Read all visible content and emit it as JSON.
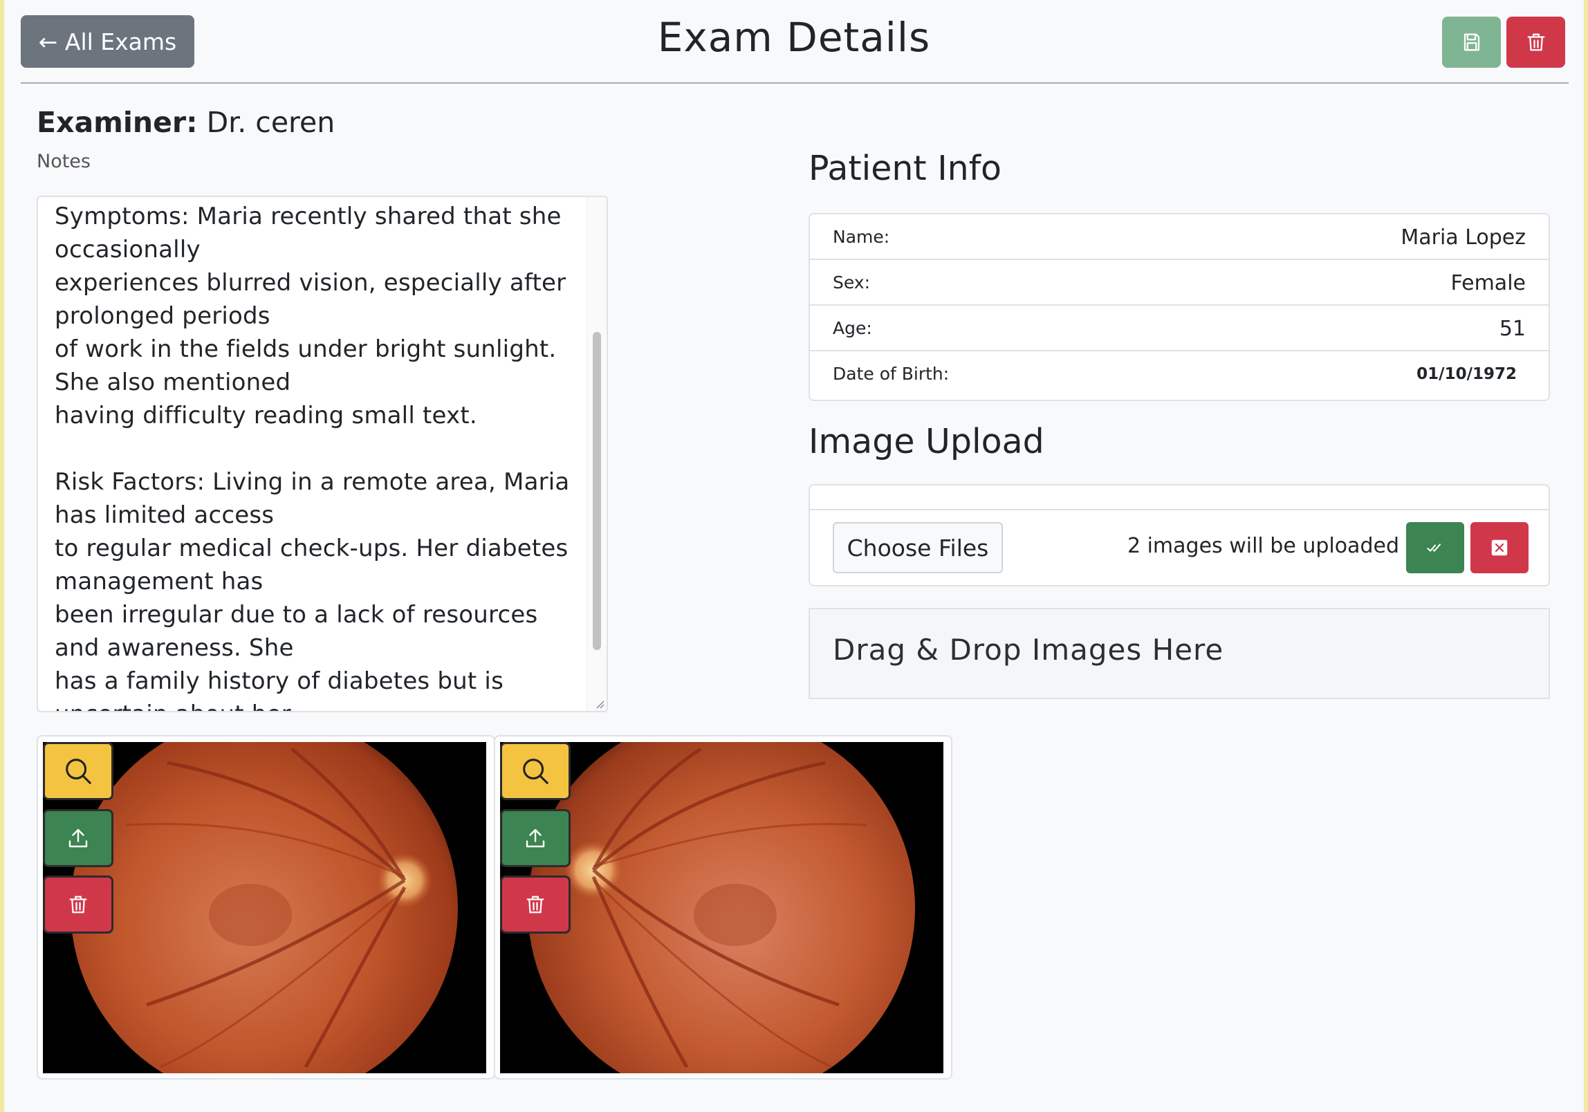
{
  "header": {
    "back_label": "← All Exams",
    "title": "Exam Details",
    "save_icon": "save-icon",
    "delete_icon": "trash-icon"
  },
  "examiner": {
    "label": "Examiner:",
    "name": "Dr. ceren"
  },
  "notes": {
    "label": "Notes",
    "text": "Symptoms: Maria recently shared that she occasionally\nexperiences blurred vision, especially after prolonged periods\nof work in the fields under bright sunlight. She also mentioned\nhaving difficulty reading small text.\n\nRisk Factors: Living in a remote area, Maria has limited access\nto regular medical check-ups. Her diabetes management has\nbeen irregular due to a lack of resources and awareness. She\nhas a family history of diabetes but is uncertain about her\nfamily's history of eye-related conditions.\n\nConvincing Evidence for Screening: Considering Maria's\nprolonged duration of diabetes and the visual disturbances she\nexperiences, it is crucial to examine her retinal health\nthoroughly. The tele-medicine consultation with a specialist\nwill be instrumental in detecting any early signs of diabetic"
  },
  "patient_info": {
    "heading": "Patient Info",
    "rows": [
      {
        "label": "Name:",
        "value": "Maria Lopez"
      },
      {
        "label": "Sex:",
        "value": "Female"
      },
      {
        "label": "Age:",
        "value": "51"
      },
      {
        "label": "Date of Birth:",
        "value": "01/10/1972"
      }
    ]
  },
  "image_upload": {
    "heading": "Image Upload",
    "choose_label": "Choose Files",
    "status": "2 images will be uploaded",
    "confirm_icon": "double-check-icon",
    "cancel_icon": "close-icon",
    "dropzone_label": "Drag & Drop Images Here"
  },
  "images": [
    {
      "eye": "right",
      "actions": [
        "zoom-icon",
        "upload-icon",
        "trash-icon"
      ]
    },
    {
      "eye": "left",
      "actions": [
        "zoom-icon",
        "upload-icon",
        "trash-icon"
      ]
    }
  ],
  "colors": {
    "secondary": "#6c757d",
    "success": "#3c8451",
    "danger": "#d0384a",
    "warning": "#f4c440"
  }
}
